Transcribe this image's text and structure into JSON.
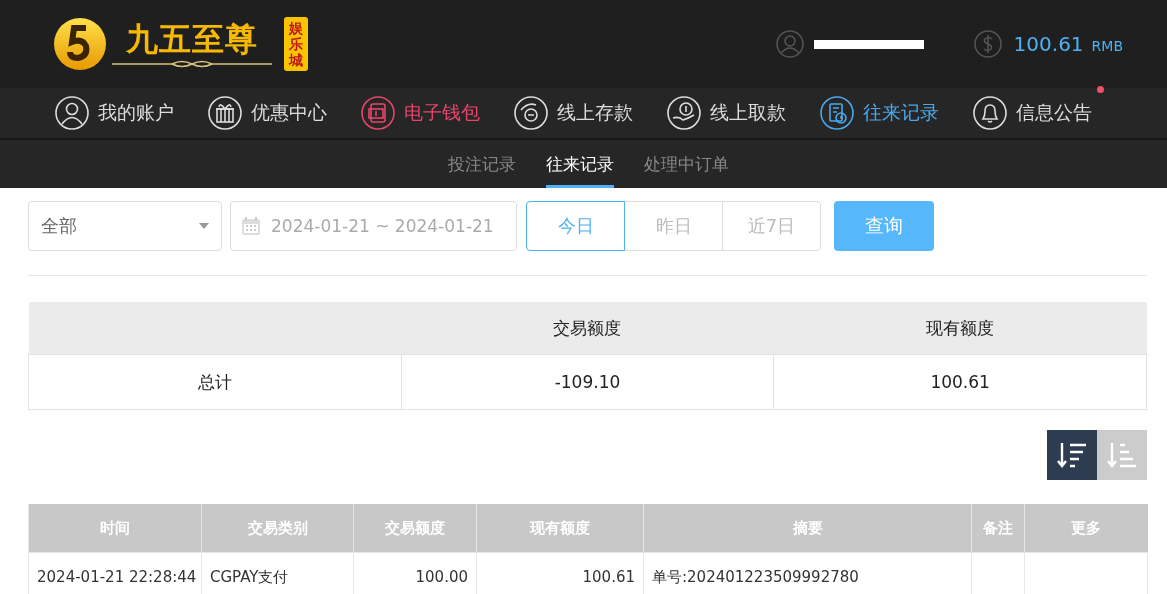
{
  "header": {
    "logo": {
      "name": "九五至尊",
      "badge": "娱乐城"
    },
    "balance": {
      "amount": "100.61",
      "currency": "RMB"
    },
    "username_redacted": true
  },
  "nav": [
    {
      "label": "我的账户",
      "selected": false,
      "hovered": false,
      "unread": false
    },
    {
      "label": "优惠中心",
      "selected": false,
      "hovered": false,
      "unread": false
    },
    {
      "label": "电子钱包",
      "selected": false,
      "hovered": true,
      "unread": false
    },
    {
      "label": "线上存款",
      "selected": false,
      "hovered": false,
      "unread": false
    },
    {
      "label": "线上取款",
      "selected": false,
      "hovered": false,
      "unread": false
    },
    {
      "label": "往来记录",
      "selected": true,
      "hovered": false,
      "unread": false
    },
    {
      "label": "信息公告",
      "selected": false,
      "hovered": false,
      "unread": true
    }
  ],
  "subtabs": [
    {
      "label": "投注记录",
      "selected": false
    },
    {
      "label": "往来记录",
      "selected": true
    },
    {
      "label": "处理中订单",
      "selected": false
    }
  ],
  "filters": {
    "type_select": {
      "value": "全部"
    },
    "date_range": {
      "value": "2024-01-21 ~ 2024-01-21"
    },
    "quick_ranges": [
      {
        "label": "今日",
        "selected": true
      },
      {
        "label": "昨日",
        "selected": false
      },
      {
        "label": "近7日",
        "selected": false
      }
    ],
    "query_button": "查询"
  },
  "summary": {
    "columns": [
      "",
      "交易额度",
      "现有额度"
    ],
    "rows": [
      [
        "总计",
        "-109.10",
        "100.61"
      ]
    ]
  },
  "sort_buttons": [
    {
      "selected": true
    },
    {
      "selected": false
    }
  ],
  "records": {
    "columns": [
      "时间",
      "交易类别",
      "交易额度",
      "现有额度",
      "摘要",
      "备注",
      "更多"
    ],
    "rows": [
      [
        "2024-01-21 22:28:44",
        "CGPAY支付",
        "100.00",
        "100.61",
        "单号:202401223509992780",
        "",
        ""
      ]
    ]
  }
}
